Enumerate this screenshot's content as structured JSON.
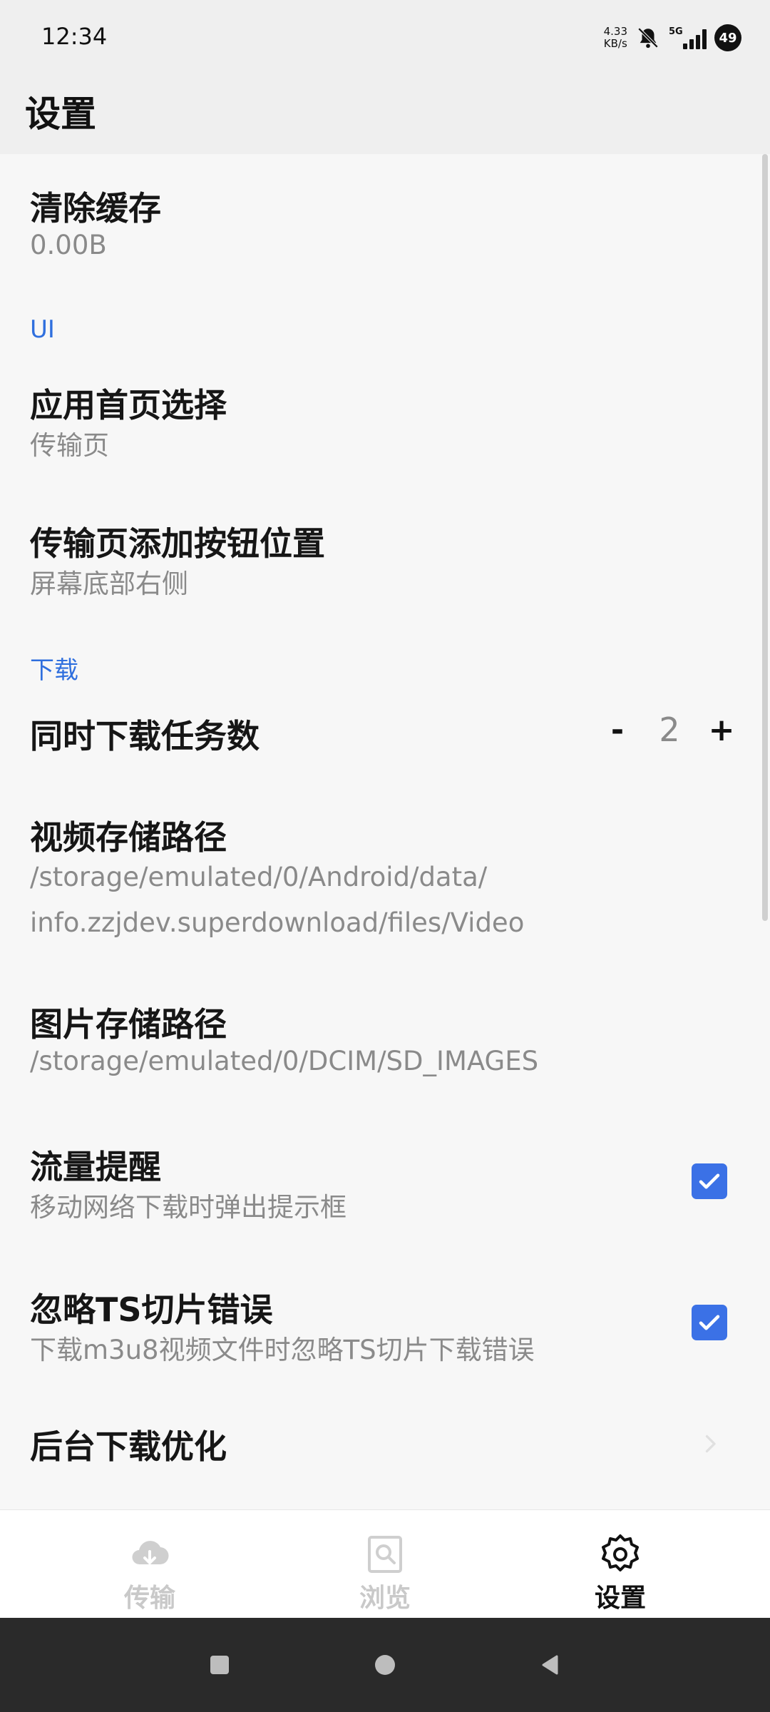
{
  "status_bar": {
    "time": "12:34",
    "net_speed_value": "4.33",
    "net_speed_unit": "KB/s",
    "network_type": "5G",
    "battery": "49"
  },
  "header": {
    "title": "设置"
  },
  "settings": {
    "clear_cache": {
      "title": "清除缓存",
      "value": "0.00B"
    },
    "section_ui": "UI",
    "home_page": {
      "title": "应用首页选择",
      "value": "传输页"
    },
    "add_button_position": {
      "title": "传输页添加按钮位置",
      "value": "屏幕底部右侧"
    },
    "section_download": "下载",
    "concurrent_tasks": {
      "title": "同时下载任务数",
      "minus": "-",
      "value": "2",
      "plus": "+"
    },
    "video_path": {
      "title": "视频存储路径",
      "line1": "/storage/emulated/0/Android/data/",
      "line2": "info.zzjdev.superdownload/files/Video"
    },
    "image_path": {
      "title": "图片存储路径",
      "value": "/storage/emulated/0/DCIM/SD_IMAGES"
    },
    "traffic_alert": {
      "title": "流量提醒",
      "desc": "移动网络下载时弹出提示框",
      "checked": true
    },
    "ignore_ts_errors": {
      "title": "忽略TS切片错误",
      "desc": "下载m3u8视频文件时忽略TS切片下载错误",
      "checked": true
    },
    "background_optimization": {
      "title": "后台下载优化"
    }
  },
  "bottom_nav": {
    "items": [
      {
        "label": "传输",
        "icon": "cloud-download-icon",
        "active": false
      },
      {
        "label": "浏览",
        "icon": "browse-search-icon",
        "active": false
      },
      {
        "label": "设置",
        "icon": "gear-icon",
        "active": true
      }
    ]
  },
  "colors": {
    "accent": "#3b71e6",
    "section_label": "#2f6fde",
    "secondary_text": "#8a8a8a",
    "inactive_nav": "#c9c9c9"
  }
}
